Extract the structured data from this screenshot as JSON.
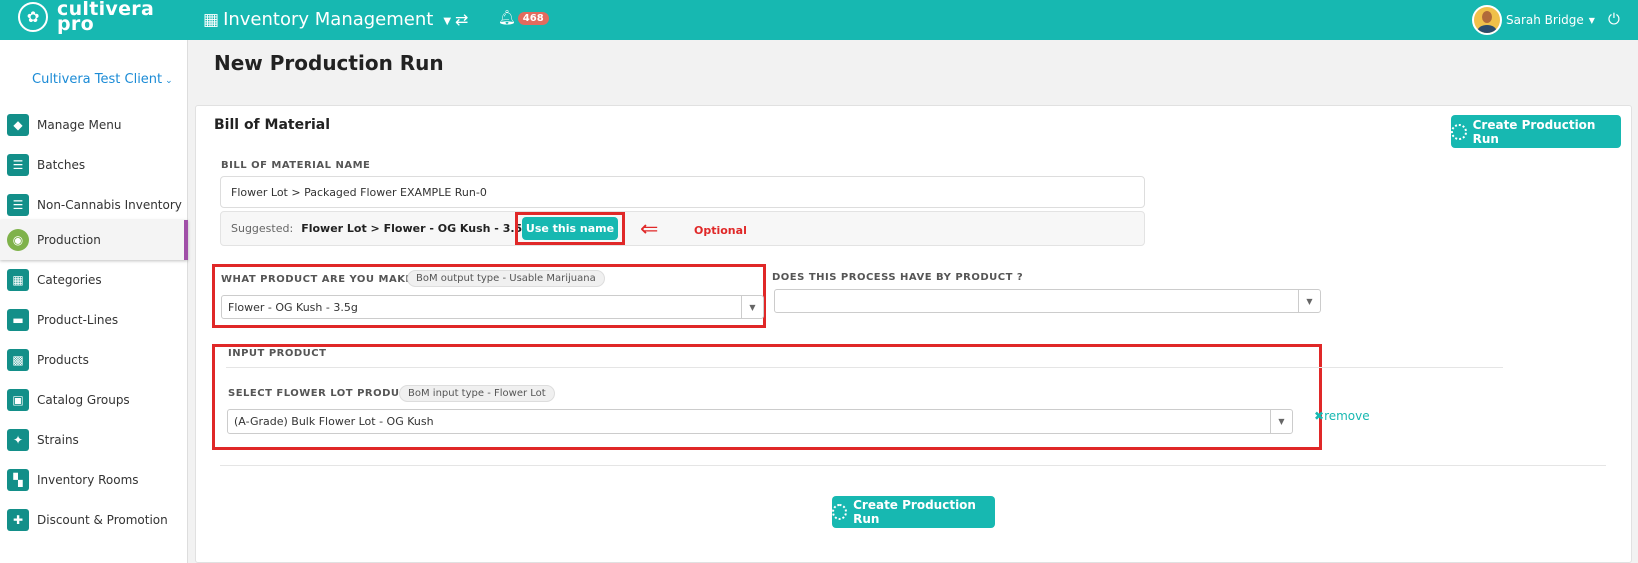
{
  "topbar": {
    "logo_line1": "cultivera",
    "logo_line2": "pro",
    "module_title": "Inventory Management",
    "notification_count": "468",
    "user_name": "Sarah Bridge"
  },
  "sidebar": {
    "client": "Cultivera Test Client",
    "items": [
      {
        "label": "Manage Menu",
        "icon": "tag-icon"
      },
      {
        "label": "Batches",
        "icon": "list-icon"
      },
      {
        "label": "Non-Cannabis Inventory",
        "icon": "list-icon"
      },
      {
        "label": "Production",
        "icon": "production-icon",
        "active": true
      },
      {
        "label": "Categories",
        "icon": "table-icon"
      },
      {
        "label": "Product-Lines",
        "icon": "product-lines-icon"
      },
      {
        "label": "Products",
        "icon": "grid-icon"
      },
      {
        "label": "Catalog Groups",
        "icon": "catalog-icon"
      },
      {
        "label": "Strains",
        "icon": "strains-icon"
      },
      {
        "label": "Inventory Rooms",
        "icon": "rooms-icon"
      },
      {
        "label": "Discount & Promotion",
        "icon": "tags-icon"
      }
    ]
  },
  "page": {
    "title": "New Production Run",
    "panel_title": "Bill of Material",
    "create_button": "Create Production Run",
    "bom_name_label": "BILL OF MATERIAL NAME",
    "bom_name_value": "Flower Lot > Packaged Flower EXAMPLE Run-0",
    "suggested_prefix": "Suggested:",
    "suggested_value": "Flower Lot > Flower - OG Kush - 3.5g Run-0",
    "use_name_button": "Use this name",
    "optional_note": "Optional",
    "product_label": "WHAT PRODUCT ARE YOU MAKING ?",
    "output_type_pill": "BoM output type - Usable Marijuana",
    "product_value": "Flower - OG Kush  - 3.5g",
    "by_product_label": "DOES THIS PROCESS HAVE BY PRODUCT ?",
    "by_product_value": "",
    "input_product_label": "INPUT PRODUCT",
    "select_flower_label": "SELECT FLOWER LOT PRODUCT",
    "input_type_pill": "BoM input type - Flower Lot",
    "input_value": "(A-Grade) Bulk Flower Lot - OG Kush",
    "remove_label": "remove",
    "bottom_button": "Create Production Run"
  },
  "colors": {
    "accent": "#17b8b1",
    "highlight": "#e02828",
    "active_border": "#a04fa7"
  }
}
